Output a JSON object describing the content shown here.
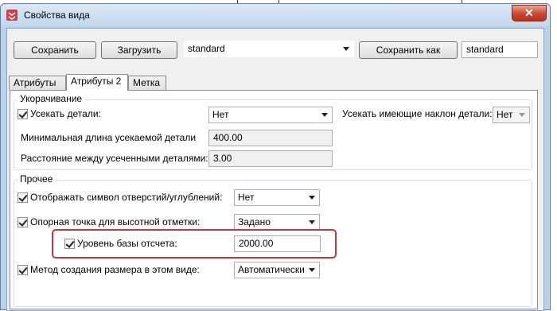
{
  "window": {
    "title": "Свойства вида",
    "close_glyph": "✕"
  },
  "toolbar": {
    "save_label": "Сохранить",
    "load_label": "Загрузить",
    "preset_value": "standard",
    "save_as_label": "Сохранить как",
    "save_as_value": "standard"
  },
  "tabs": [
    {
      "label": "Атрибуты 1",
      "active": false
    },
    {
      "label": "Атрибуты 2",
      "active": true
    },
    {
      "label": "Метка",
      "active": false
    }
  ],
  "shortening": {
    "group_label": "Укорачивание",
    "cut_parts_label": "Усекать детали:",
    "cut_parts_checked": true,
    "cut_parts_value": "Нет",
    "cut_sloped_label": "Усекать имеющие наклон детали:",
    "cut_sloped_value": "Нет",
    "min_length_label": "Минимальная длина усекаемой детали",
    "min_length_value": "400.00",
    "gap_label": "Расстояние между усеченными деталями:",
    "gap_value": "3.00"
  },
  "other": {
    "group_label": "Прочее",
    "holes_label": "Отображать символ отверстий/углублений:",
    "holes_checked": true,
    "holes_value": "Нет",
    "ref_point_label": "Опорная точка для высотной отметки:",
    "ref_point_checked": true,
    "ref_point_value": "Задано",
    "base_level_label": "Уровень базы отсчета:",
    "base_level_checked": true,
    "base_level_value": "2000.00",
    "dim_method_label": "Метод создания размера в этом виде:",
    "dim_method_checked": true,
    "dim_method_value": "Автоматически"
  },
  "colors": {
    "highlight": "#c0393b",
    "window_frame": "#b9d1ea",
    "close_button": "#c9462c"
  }
}
